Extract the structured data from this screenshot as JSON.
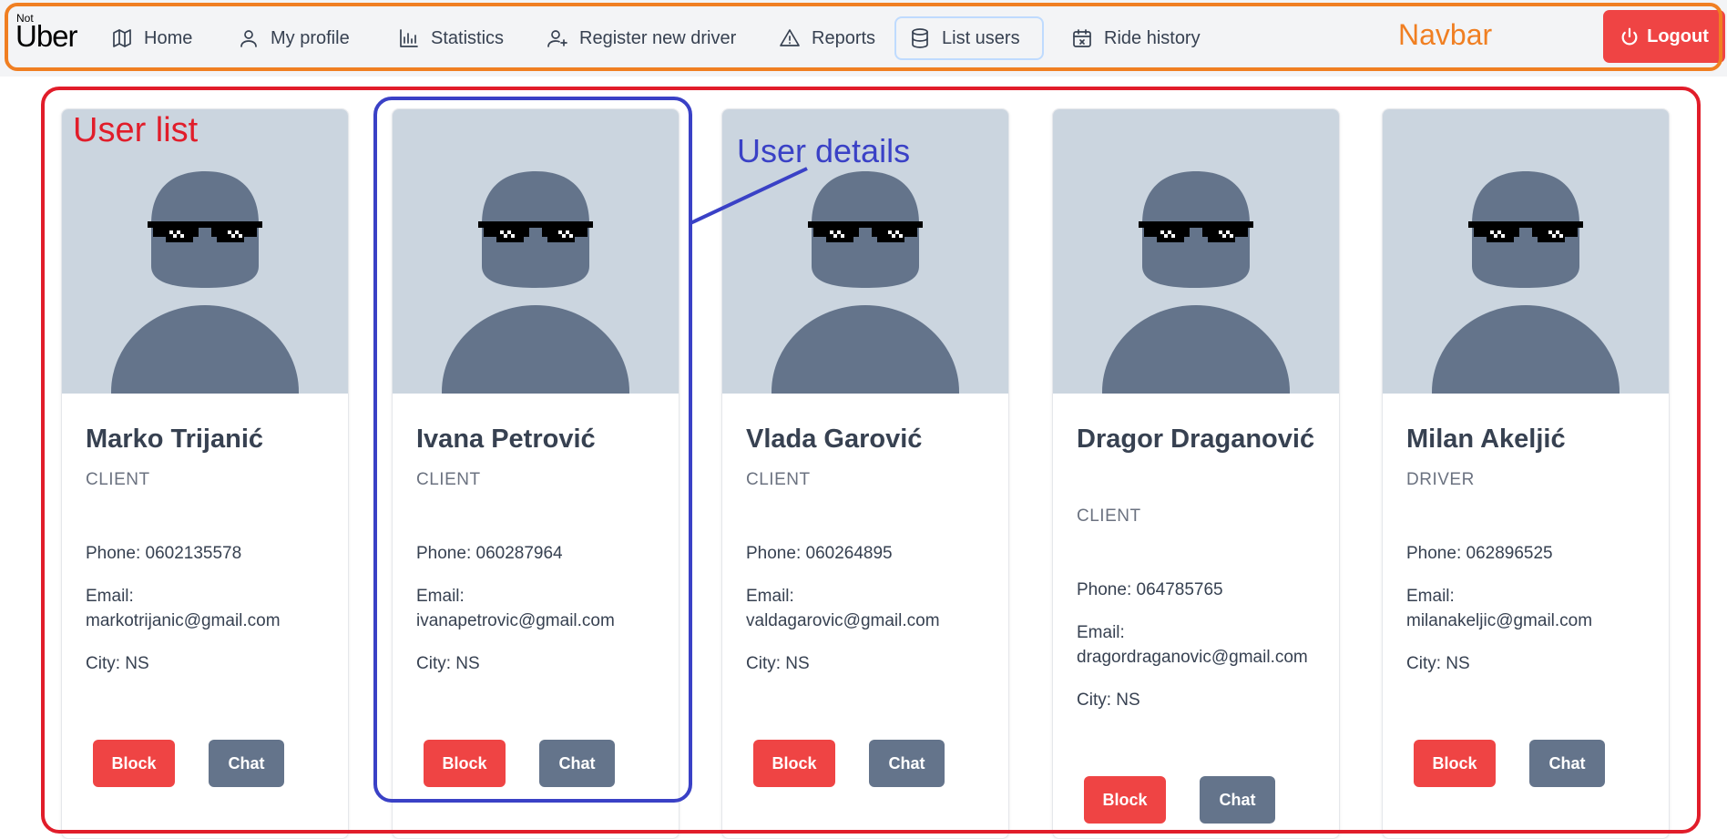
{
  "navbar": {
    "logo_small": "Not",
    "logo_text": "Uber",
    "items": [
      {
        "label": "Home",
        "icon": "map-icon"
      },
      {
        "label": "My profile",
        "icon": "user-icon"
      },
      {
        "label": "Statistics",
        "icon": "bar-chart-icon"
      },
      {
        "label": "Register new driver",
        "icon": "user-plus-icon"
      },
      {
        "label": "Reports",
        "icon": "warning-icon"
      },
      {
        "label": "List users",
        "icon": "database-icon"
      },
      {
        "label": "Ride history",
        "icon": "calendar-icon"
      }
    ],
    "active_item": "List users",
    "logout_label": "Logout"
  },
  "annotations": {
    "navbar": "Navbar",
    "user_list": "User list",
    "user_details": "User details"
  },
  "users": [
    {
      "name": "Marko Trijanić",
      "role": "CLIENT",
      "phone": "Phone: 0602135578",
      "email_label": "Email:",
      "email": "markotrijanic@gmail.com",
      "city": "City: NS",
      "block_label": "Block",
      "chat_label": "Chat"
    },
    {
      "name": "Ivana Petrović",
      "role": "CLIENT",
      "phone": "Phone: 060287964",
      "email_label": "Email:",
      "email": "ivanapetrovic@gmail.com",
      "city": "City: NS",
      "block_label": "Block",
      "chat_label": "Chat"
    },
    {
      "name": "Vlada Garović",
      "role": "CLIENT",
      "phone": "Phone: 060264895",
      "email_label": "Email:",
      "email": "valdagarovic@gmail.com",
      "city": "City: NS",
      "block_label": "Block",
      "chat_label": "Chat"
    },
    {
      "name": "Dragor Draganović",
      "role": "CLIENT",
      "phone": "Phone: 064785765",
      "email_label": "Email:",
      "email": "dragordraganovic@gmail.com",
      "city": "City: NS",
      "block_label": "Block",
      "chat_label": "Chat"
    },
    {
      "name": "Milan Akeljić",
      "role": "DRIVER",
      "phone": "Phone: 062896525",
      "email_label": "Email:",
      "email": "milanakeljic@gmail.com",
      "city": "City: NS",
      "block_label": "Block",
      "chat_label": "Chat"
    }
  ],
  "colors": {
    "navbar_bg": "#f3f4f6",
    "navbar_frame": "#f07f22",
    "user_list_frame": "#e11d2a",
    "user_details_frame": "#3a41c6",
    "block_button": "#ef4444",
    "chat_button": "#64748b",
    "avatar_bg": "#cbd5df",
    "avatar_figure": "#64748b"
  }
}
